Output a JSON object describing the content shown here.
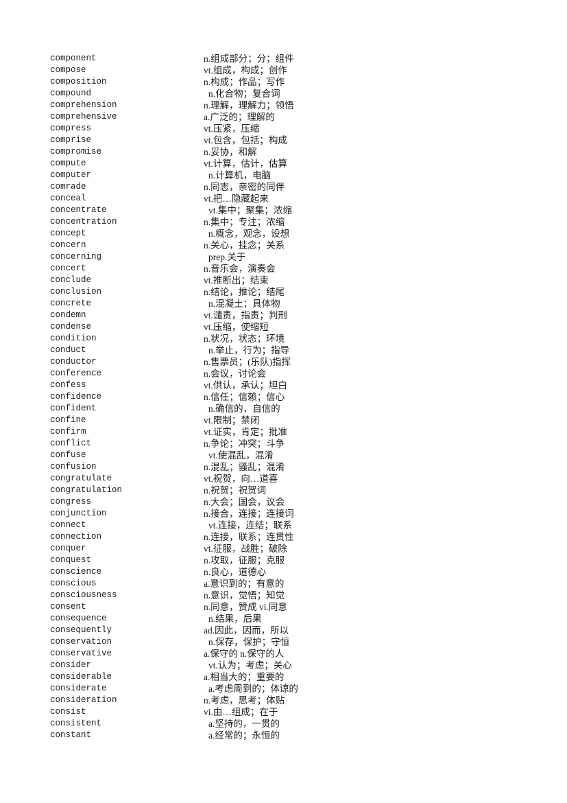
{
  "page": {
    "background_color": "#ffffff",
    "text_color": "#1c1c1c",
    "kind": "vocabulary-word-list",
    "language_pair": "English-Chinese"
  },
  "entries": [
    {
      "term": "component",
      "definition": "n.组成部分；分；组件",
      "indent": false
    },
    {
      "term": "compose",
      "definition": "vt.组成，构成；创作",
      "indent": false
    },
    {
      "term": "composition",
      "definition": "n.构成；作品；写作",
      "indent": false
    },
    {
      "term": "compound",
      "definition": "n.化合物；复合词",
      "indent": true
    },
    {
      "term": "comprehension",
      "definition": "n.理解，理解力；领悟",
      "indent": false
    },
    {
      "term": "comprehensive",
      "definition": "a.广泛的；理解的",
      "indent": false
    },
    {
      "term": "compress",
      "definition": "vt.压紧，压缩",
      "indent": false
    },
    {
      "term": "comprise",
      "definition": "vt.包含，包括；构成",
      "indent": false
    },
    {
      "term": "compromise",
      "definition": "n.妥协，和解",
      "indent": false
    },
    {
      "term": "compute",
      "definition": "vt.计算，估计，估算",
      "indent": false
    },
    {
      "term": "computer",
      "definition": "n.计算机，电脑",
      "indent": true
    },
    {
      "term": "comrade",
      "definition": "n.同志，亲密的同伴",
      "indent": false
    },
    {
      "term": "conceal",
      "definition": "vt.把…隐藏起来",
      "indent": false
    },
    {
      "term": "concentrate",
      "definition": "vt.集中；聚集；浓缩",
      "indent": true
    },
    {
      "term": "concentration",
      "definition": "n.集中；专注；浓缩",
      "indent": false
    },
    {
      "term": "concept",
      "definition": "n.概念，观念，设想",
      "indent": true
    },
    {
      "term": "concern",
      "definition": "n.关心，挂念；关系",
      "indent": false
    },
    {
      "term": "concerning",
      "definition": "prep.关于",
      "indent": true
    },
    {
      "term": "concert",
      "definition": "n.音乐会，演奏会",
      "indent": false
    },
    {
      "term": "conclude",
      "definition": "vt.推断出；结束",
      "indent": false
    },
    {
      "term": "conclusion",
      "definition": "n.结论，推论；结尾",
      "indent": false
    },
    {
      "term": "concrete",
      "definition": "n.混凝土；具体物",
      "indent": true
    },
    {
      "term": "condemn",
      "definition": "vt.谴责，指责；判刑",
      "indent": false
    },
    {
      "term": "condense",
      "definition": "vt.压缩，使缩短",
      "indent": false
    },
    {
      "term": "condition",
      "definition": "n.状况，状态；环境",
      "indent": false
    },
    {
      "term": "conduct",
      "definition": "n.举止，行为；指导",
      "indent": true
    },
    {
      "term": "conductor",
      "definition": "n.售票员；(乐队)指挥",
      "indent": false
    },
    {
      "term": "conference",
      "definition": "n.会议，讨论会",
      "indent": false
    },
    {
      "term": "confess",
      "definition": "vt.供认，承认；坦白",
      "indent": false
    },
    {
      "term": "confidence",
      "definition": "n.信任；信赖；信心",
      "indent": false
    },
    {
      "term": "confident",
      "definition": "n.确信的，自信的",
      "indent": true
    },
    {
      "term": "confine",
      "definition": "vt.限制；禁闭",
      "indent": false
    },
    {
      "term": "confirm",
      "definition": "vt.证实，肯定；批准",
      "indent": false
    },
    {
      "term": "conflict",
      "definition": "n.争论；冲突；斗争",
      "indent": false
    },
    {
      "term": "confuse",
      "definition": "vt.使混乱，混淆",
      "indent": true
    },
    {
      "term": "confusion",
      "definition": "n.混乱；骚乱；混淆",
      "indent": false
    },
    {
      "term": "congratulate",
      "definition": "vt.祝贺，向…道喜",
      "indent": false
    },
    {
      "term": "congratulation",
      "definition": "n.祝贺；祝贺词",
      "indent": false
    },
    {
      "term": "congress",
      "definition": "n.大会；国会，议会",
      "indent": false
    },
    {
      "term": "conjunction",
      "definition": "n.接合，连接；连接词",
      "indent": false
    },
    {
      "term": "connect",
      "definition": "vt.连接，连结；联系",
      "indent": true
    },
    {
      "term": "connection",
      "definition": "n.连接，联系；连贯性",
      "indent": false
    },
    {
      "term": "conquer",
      "definition": "vt.征服，战胜；破除",
      "indent": false
    },
    {
      "term": "conquest",
      "definition": "n.攻取，征服；克服",
      "indent": false
    },
    {
      "term": "conscience",
      "definition": "n.良心，道德心",
      "indent": false
    },
    {
      "term": "conscious",
      "definition": "a.意识到的；有意的",
      "indent": false
    },
    {
      "term": "consciousness",
      "definition": "n.意识，觉悟；知觉",
      "indent": false
    },
    {
      "term": "consent",
      "definition": "n.同意，赞成 vi.同意",
      "indent": false
    },
    {
      "term": "consequence",
      "definition": "n.结果，后果",
      "indent": true
    },
    {
      "term": "consequently",
      "definition": "ad.因此，因而，所以",
      "indent": false
    },
    {
      "term": "conservation",
      "definition": "n.保存，保护；守恒",
      "indent": true
    },
    {
      "term": "conservative",
      "definition": "a.保守的 n.保守的人",
      "indent": false
    },
    {
      "term": "consider",
      "definition": "vt.认为；考虑；关心",
      "indent": true
    },
    {
      "term": "considerable",
      "definition": "a.相当大的；重要的",
      "indent": false
    },
    {
      "term": "considerate",
      "definition": "a.考虑周到的；体谅的",
      "indent": true
    },
    {
      "term": "consideration",
      "definition": "n.考虑，思考；体贴",
      "indent": false
    },
    {
      "term": "consist",
      "definition": "vi.由…组成；在于",
      "indent": false
    },
    {
      "term": "consistent",
      "definition": "a.坚持的，一贯的",
      "indent": true
    },
    {
      "term": "constant",
      "definition": "a.经常的；永恒的",
      "indent": true
    }
  ]
}
